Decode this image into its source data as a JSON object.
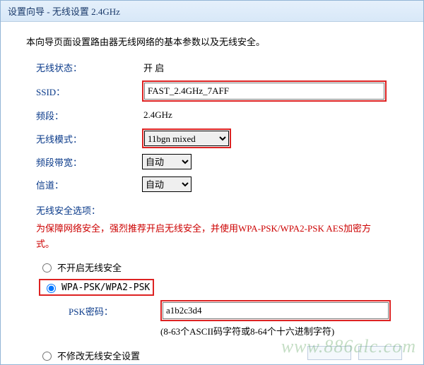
{
  "title": "设置向导 - 无线设置 2.4GHz",
  "intro": "本向导页面设置路由器无线网络的基本参数以及无线安全。",
  "fields": {
    "status_label": "无线状态：",
    "status_value": "开 启",
    "ssid_label": "SSID：",
    "ssid_value": "FAST_2.4GHz_7AFF",
    "band_label": "频段：",
    "band_value": "2.4GHz",
    "mode_label": "无线模式：",
    "mode_value": "11bgn mixed",
    "bandwidth_label": "频段带宽：",
    "bandwidth_value": "自动",
    "channel_label": "信道：",
    "channel_value": "自动"
  },
  "security": {
    "title": "无线安全选项：",
    "warn": "为保障网络安全，强烈推荐开启无线安全，并使用WPA-PSK/WPA2-PSK AES加密方式。",
    "opt_none": "不开启无线安全",
    "opt_wpa": "WPA-PSK/WPA2-PSK",
    "psk_label": "PSK密码：",
    "psk_value": "a1b2c3d4",
    "psk_hint": "(8-63个ASCII码字符或8-64个十六进制字符)",
    "opt_keep": "不修改无线安全设置"
  },
  "watermark": "www.886alc.com"
}
